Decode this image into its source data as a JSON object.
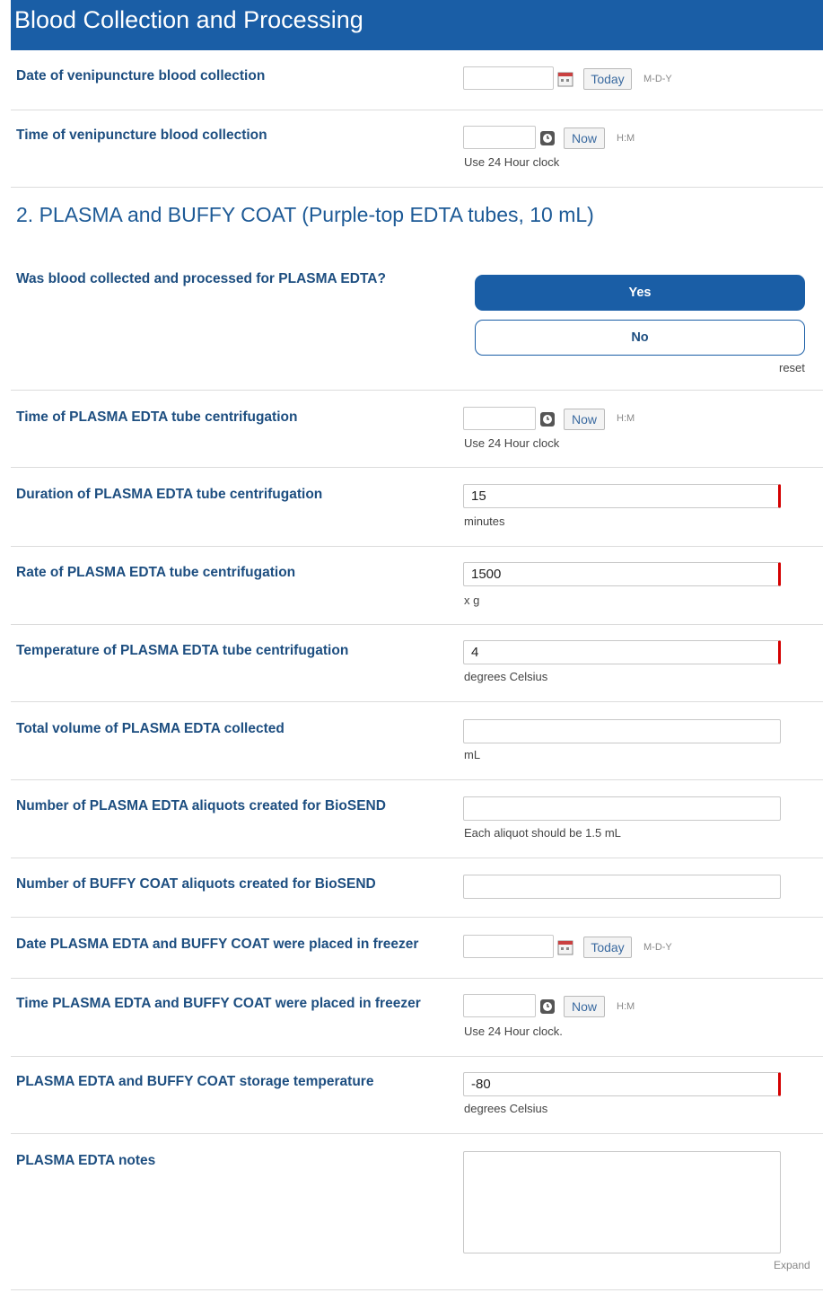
{
  "header": {
    "title": "Blood Collection and Processing"
  },
  "section": {
    "title": "2. PLASMA and BUFFY COAT (Purple-top EDTA tubes, 10 mL)"
  },
  "fields": {
    "collection_date": {
      "label": "Date of venipuncture blood collection",
      "value": "",
      "button": "Today",
      "format": "M-D-Y"
    },
    "collection_time": {
      "label": "Time of venipuncture blood collection",
      "value": "",
      "button": "Now",
      "format": "H:M",
      "note": "Use 24 Hour clock"
    },
    "processed": {
      "label": "Was blood collected and processed for PLASMA EDTA?",
      "yes": "Yes",
      "no": "No",
      "reset": "reset",
      "selected": "Yes"
    },
    "centrifuge_time": {
      "label": "Time of PLASMA EDTA tube centrifugation",
      "value": "",
      "button": "Now",
      "format": "H:M",
      "note": "Use 24 Hour clock"
    },
    "centrifuge_duration": {
      "label": "Duration of PLASMA EDTA tube centrifugation",
      "value": "15",
      "note": "minutes"
    },
    "centrifuge_rate": {
      "label": "Rate of PLASMA EDTA tube centrifugation",
      "value": "1500",
      "note": "x g"
    },
    "centrifuge_temp": {
      "label": "Temperature of PLASMA EDTA tube centrifugation",
      "value": "4",
      "note": "degrees Celsius"
    },
    "plasma_volume": {
      "label": "Total volume of PLASMA EDTA collected",
      "value": "",
      "note": "mL"
    },
    "plasma_aliquots": {
      "label": "Number of PLASMA EDTA aliquots created for BioSEND",
      "value": "",
      "note": "Each aliquot should be 1.5 mL"
    },
    "buffy_aliquots": {
      "label": "Number of BUFFY COAT aliquots created for BioSEND",
      "value": ""
    },
    "freezer_date": {
      "label": "Date PLASMA EDTA and BUFFY COAT were placed in freezer",
      "value": "",
      "button": "Today",
      "format": "M-D-Y"
    },
    "freezer_time": {
      "label": "Time PLASMA EDTA and BUFFY COAT were placed in freezer",
      "value": "",
      "button": "Now",
      "format": "H:M",
      "note": "Use 24 Hour clock."
    },
    "storage_temp": {
      "label": "PLASMA EDTA and BUFFY COAT storage temperature",
      "value": "-80",
      "note": "degrees Celsius"
    },
    "notes": {
      "label": "PLASMA EDTA notes",
      "value": "",
      "expand": "Expand"
    }
  },
  "colors": {
    "header_bg": "#1a5ea6",
    "label": "#1d4e80",
    "required_marker": "#d40000"
  }
}
